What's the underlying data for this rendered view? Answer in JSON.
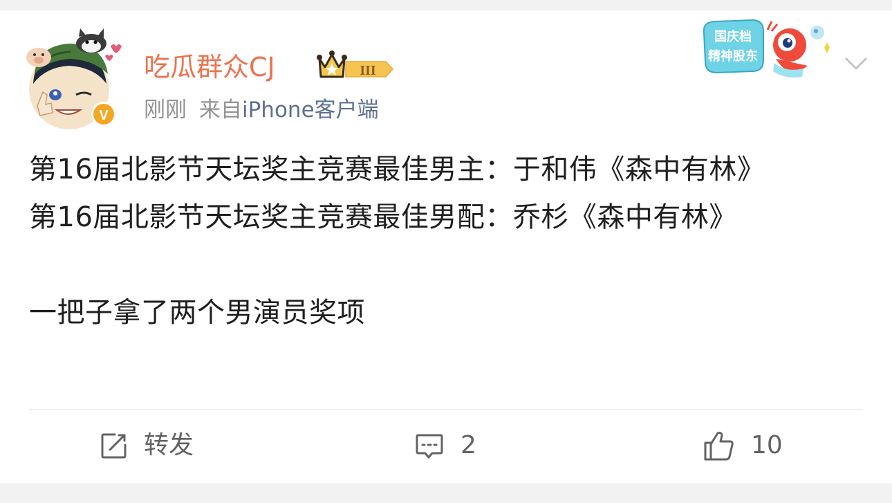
{
  "post": {
    "author": {
      "name": "吃瓜群众CJ",
      "verified_badge": "V",
      "vip_level": "III"
    },
    "meta": {
      "time": "刚刚",
      "source_prefix": "来自",
      "source_client": "iPhone客户端"
    },
    "sticker": {
      "line1": "国庆档",
      "line2": "精神股东"
    },
    "content": {
      "line1": "第16届北影节天坛奖主竞赛最佳男主：于和伟《森中有林》",
      "line2": "第16届北影节天坛奖主竞赛最佳男配：乔杉《森中有林》",
      "line3": "一把子拿了两个男演员奖项"
    },
    "actions": {
      "repost_label": "转发",
      "comment_count": "2",
      "like_count": "10"
    }
  },
  "colors": {
    "username": "#eb7350",
    "meta": "#939393",
    "source_client": "#5d6f92",
    "text": "#1f1f1f",
    "action": "#636363",
    "verified": "#f5a623"
  },
  "icons": {
    "repost": "edit-square-icon",
    "comment": "comment-bubble-icon",
    "like": "thumbs-up-icon",
    "menu": "chevron-down-icon",
    "vip": "crown-icon"
  }
}
